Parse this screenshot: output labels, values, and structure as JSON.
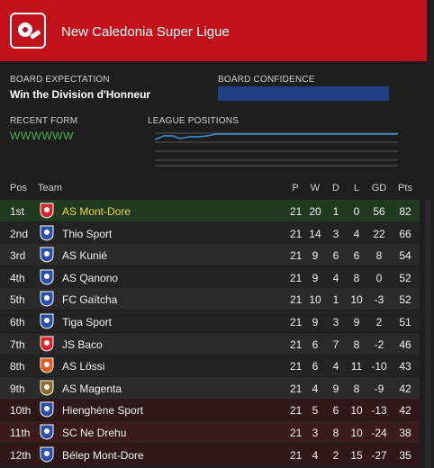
{
  "header": {
    "title": "New Caledonia Super Ligue"
  },
  "board": {
    "expectation_label": "BOARD EXPECTATION",
    "expectation_value": "Win the Division d'Honneur",
    "confidence_label": "BOARD CONFIDENCE"
  },
  "recent_form": {
    "label": "RECENT FORM",
    "value": "WWWWWW"
  },
  "league_positions": {
    "label": "LEAGUE POSITIONS"
  },
  "columns": {
    "pos": "Pos",
    "team": "Team",
    "p": "P",
    "w": "W",
    "d": "D",
    "l": "L",
    "gd": "GD",
    "pts": "Pts"
  },
  "rows": [
    {
      "pos": "1st",
      "team": "AS Mont-Dore",
      "p": "21",
      "w": "20",
      "d": "1",
      "l": "0",
      "gd": "56",
      "pts": "82"
    },
    {
      "pos": "2nd",
      "team": "Thio Sport",
      "p": "21",
      "w": "14",
      "d": "3",
      "l": "4",
      "gd": "22",
      "pts": "66"
    },
    {
      "pos": "3rd",
      "team": "AS Kunié",
      "p": "21",
      "w": "9",
      "d": "6",
      "l": "6",
      "gd": "8",
      "pts": "54"
    },
    {
      "pos": "4th",
      "team": "AS Qanono",
      "p": "21",
      "w": "9",
      "d": "4",
      "l": "8",
      "gd": "0",
      "pts": "52"
    },
    {
      "pos": "5th",
      "team": "FC Gaïtcha",
      "p": "21",
      "w": "10",
      "d": "1",
      "l": "10",
      "gd": "-3",
      "pts": "52"
    },
    {
      "pos": "6th",
      "team": "Tiga Sport",
      "p": "21",
      "w": "9",
      "d": "3",
      "l": "9",
      "gd": "2",
      "pts": "51"
    },
    {
      "pos": "7th",
      "team": "JS Baco",
      "p": "21",
      "w": "6",
      "d": "7",
      "l": "8",
      "gd": "-2",
      "pts": "46"
    },
    {
      "pos": "8th",
      "team": "AS Lössi",
      "p": "21",
      "w": "6",
      "d": "4",
      "l": "11",
      "gd": "-10",
      "pts": "43"
    },
    {
      "pos": "9th",
      "team": "AS Magenta",
      "p": "21",
      "w": "4",
      "d": "9",
      "l": "8",
      "gd": "-9",
      "pts": "42"
    },
    {
      "pos": "10th",
      "team": "Hienghène Sport",
      "p": "21",
      "w": "5",
      "d": "6",
      "l": "10",
      "gd": "-13",
      "pts": "42"
    },
    {
      "pos": "11th",
      "team": "SC Ne Drehu",
      "p": "21",
      "w": "3",
      "d": "8",
      "l": "10",
      "gd": "-24",
      "pts": "38"
    },
    {
      "pos": "12th",
      "team": "Bélep Mont-Dore",
      "p": "21",
      "w": "4",
      "d": "2",
      "l": "15",
      "gd": "-27",
      "pts": "35"
    }
  ],
  "colors": {
    "header": "#c1121c",
    "highlight_text": "#f2d43a",
    "form": "#4caf50",
    "confidence": "#1c3f86"
  }
}
